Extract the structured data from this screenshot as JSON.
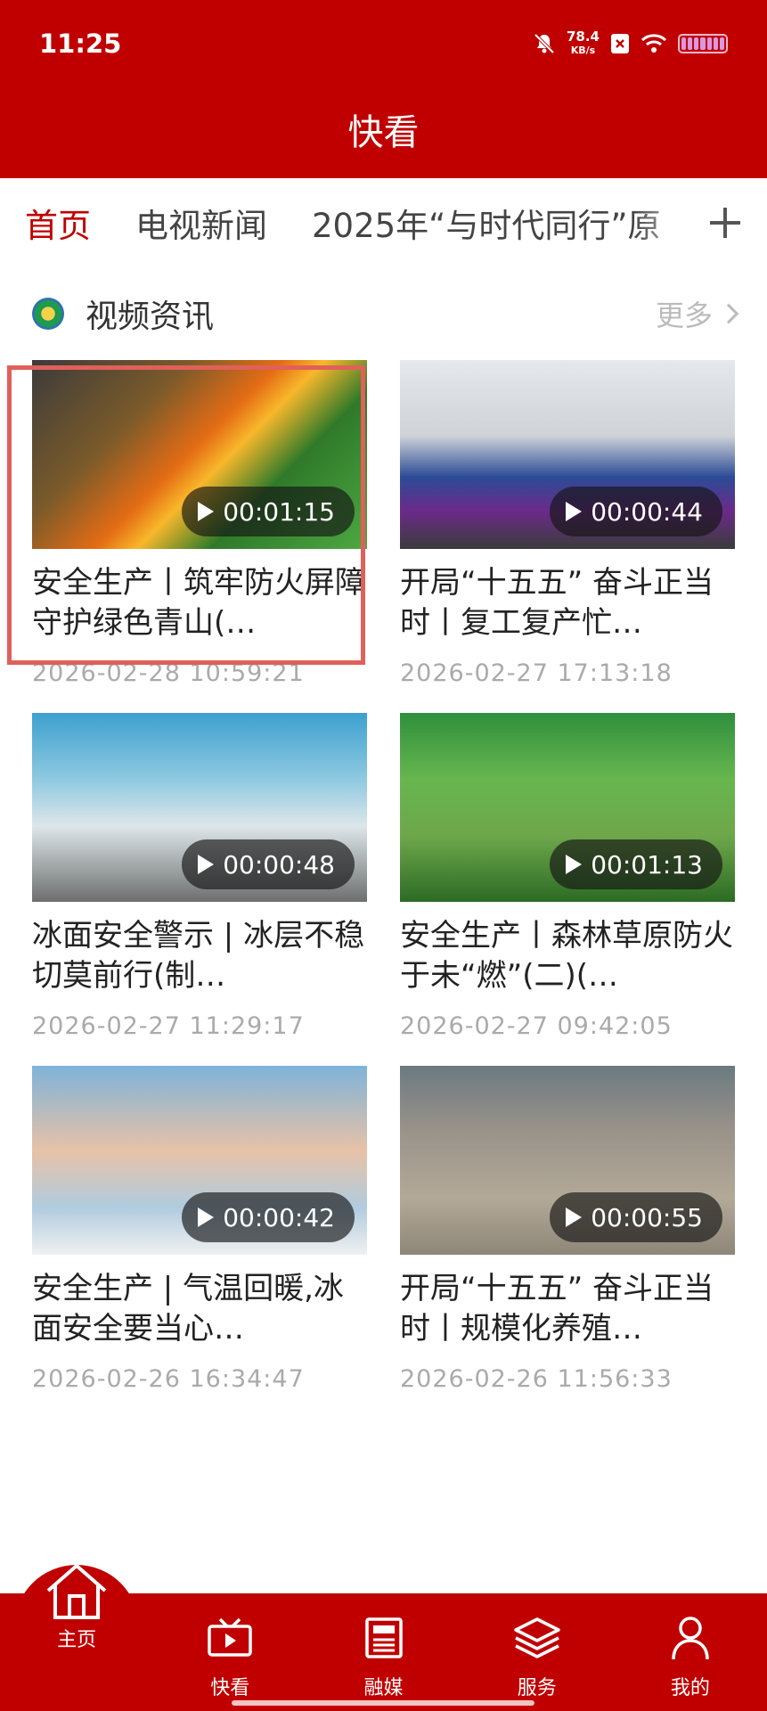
{
  "status_bar": {
    "time": "11:25",
    "net_speed_value": "78.4",
    "net_speed_unit": "KB/s"
  },
  "header": {
    "title": "快看"
  },
  "tabs": [
    {
      "label": "首页",
      "active": true
    },
    {
      "label": "电视新闻",
      "active": false
    },
    {
      "label": "2025年“与时代同行”原",
      "active": false
    }
  ],
  "section": {
    "title": "视频资讯",
    "more_label": "更多"
  },
  "videos": [
    {
      "title": "安全生产丨筑牢防火屏障 守护绿色青山(…",
      "duration": "00:01:15",
      "date": "2026-02-28 10:59:21"
    },
    {
      "title": "开局“十五五” 奋斗正当时丨复工复产忙…",
      "duration": "00:00:44",
      "date": "2026-02-27 17:13:18"
    },
    {
      "title": "冰面安全警示 | 冰层不稳 切莫前行(制…",
      "duration": "00:00:48",
      "date": "2026-02-27 11:29:17"
    },
    {
      "title": "安全生产丨森林草原防火于未“燃”(二)(…",
      "duration": "00:01:13",
      "date": "2026-02-27 09:42:05"
    },
    {
      "title": "安全生产 | 气温回暖,冰面安全要当心…",
      "duration": "00:00:42",
      "date": "2026-02-26 16:34:47"
    },
    {
      "title": "开局“十五五” 奋斗正当时丨规模化养殖…",
      "duration": "00:00:55",
      "date": "2026-02-26 11:56:33"
    }
  ],
  "bottom_nav": [
    {
      "label": "主页",
      "icon": "home-icon",
      "active": true
    },
    {
      "label": "快看",
      "icon": "tv-icon",
      "active": false
    },
    {
      "label": "融媒",
      "icon": "newspaper-icon",
      "active": false
    },
    {
      "label": "服务",
      "icon": "layers-icon",
      "active": false
    },
    {
      "label": "我的",
      "icon": "user-icon",
      "active": false
    }
  ],
  "colors": {
    "brand_red": "#c00000",
    "highlight_border": "#e0605a"
  }
}
